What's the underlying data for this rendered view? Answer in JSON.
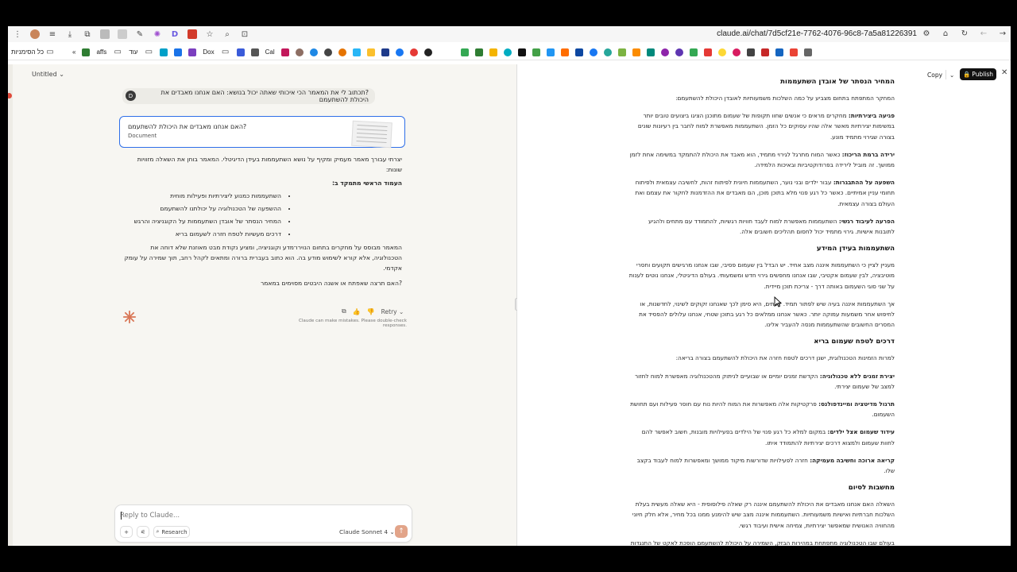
{
  "browser": {
    "url": "claude.ai/chat/7d5cf21e-7762-4076-96c8-7a5a81226391"
  },
  "bookmarks": {
    "first_label": "כל הסימניות",
    "more_label": "«",
    "items": [
      "affs",
      "עוד",
      "Dox",
      "Cal"
    ]
  },
  "chat": {
    "title": "Untitled",
    "user_avatar": "D",
    "user_message": "?תכתוב לי את המאמר הכי איכותי שאתה יכול בנושא: האם אנחנו מאבדים את היכולת להשתעמם",
    "doc_card": {
      "title": "?האם אנחנו מאבדים את היכולת להשתעמם",
      "subtitle": "Document"
    },
    "answer": {
      "intro": "יצרתי עבורך מאמר מעמיק ומקיף על נושא השתעממות בעידן הדיגיטלי. המאמר בוחן את השאלה מזוויות שונות:",
      "heading": "העמוד הראשי מתמקד ב:",
      "bullets": [
        "השתעממות כמנוע ליצירתיות ופעילות מוחית",
        "ההשפעה של הטכנולוגיה על יכולתנו להשתעמם",
        "המחיר הנסתר של אובדן השתעממות על הקוגניציה והרגש",
        "דרכים מעשיות לטפח חזרה לשעמום בריא"
      ],
      "para2": "המאמר מבוסס על מחקרים בתחום הנוירו־מדע וקוגניציה, ומציע נקודת מבט מאוזנת שלא דוחה את הטכנולוגיה, אלא קורא לשימוש מודע בה. הוא כתוב בעברית ברורה ומתאים לקהל רחב, תוך שמירה על עומק אקדמי.",
      "question": "?האם תרצה שאפתח או אשנה היבטים מסוימים במאמר"
    },
    "actions": {
      "retry_label": "Retry"
    },
    "disclaimer": "Claude can make mistakes. Please double-check responses.",
    "composer": {
      "placeholder": "Reply to Claude...",
      "research_label": "Research",
      "model_label": "Claude Sonnet 4"
    }
  },
  "artifact": {
    "copy_label": "Copy",
    "publish_label": "Publish",
    "sections": [
      {
        "heading": "המחיר הנסתר של אובדן השתעממות",
        "intro": "המחקר המתפתח בתחום מצביע על כמה השלכות משמעותיות לאובדן היכולת להשתעמם:",
        "items": [
          {
            "bold": "פגיעה ביצירתיות:",
            "text": "מחקרים מראים כי אנשים שחוו תקופות של שעמום מתוכנן הציגו ביצועים טובים יותר במשימות יצירתיות מאשר אלה שהיו עסוקים כל הזמן. השתעממות מאפשרת למוח לחבר בין רעיונות שונים בצורה שגירוי מתמיד מונע."
          },
          {
            "bold": "ירידה ברמת הריכוז:",
            "text": "כאשר המוח מתרגל לגירוי מתמיד, הוא מאבד את היכולת להתמקד במשימה אחת לזמן ממושך. זה מוביל לירידה בפרודוקטיביות ובאיכות הלמידה."
          },
          {
            "bold": "השפעה על ההתבגרות:",
            "text": "עבור ילדים ובני נוער, השתעממות חיונית לפיתוח זהות, לחשיבה עצמאית ולפיתוח תחומי עניין אמיתיים. כאשר כל רגע פנוי מלא בתוכן מוכן, הם מאבדים את ההזדמנות לחקור את עצמם ואת העולם בצורה עצמאית."
          },
          {
            "bold": "הפרעה לעיבוד רגשי:",
            "text": "השתעממות מאפשרת למוח לעבד חוויות רגשיות, להתמודד עם מתחים ולהגיע לתובנות אישיות. גירוי מתמיד יכול לחסום תהליכים חשובים אלה."
          }
        ]
      },
      {
        "heading": "השתעממות בעידן המידע",
        "paragraphs": [
          "מעניין לציין כי השתעממות איננה מצב אחיד. יש הבדל בין שעמום פסיבי, שבו אנחנו מרגישים תקועים וחסרי מוטיבציה, לבין שעמום אקטיבי, שבו אנחנו מחפשים גירוי חדש ומשמעותי. בעולם הדיגיטלי, אנחנו נוטים לענות על שני סוגי השעמום באותה דרך - צריכת תוכן מיידית.",
          "אך השתעממות איננה בעיה שיש לפתור תמיד. לעתים, היא סימן לכך שאנחנו זקוקים לשינוי, לחדשנות, או לחיפוש אחר משמעות עמוקה יותר. כאשר אנחנו ממלאים כל רגע בתוכן שטחי, אנחנו עלולים להפסיד את המסרים החשובים שהשתעממות מנסה להעביר אלינו."
        ]
      },
      {
        "heading": "דרכים לטפח שעמום בריא",
        "intro": "למרות הזמינות הטכנולוגית, ישנן דרכים לטפח חזרה את היכולת להשתעמם בצורה בריאה:",
        "items": [
          {
            "bold": "יצירת זמנים ללא טכנולוגיה:",
            "text": "הקדשת זמנים יומיים או שבועיים לניתוק מהטכנולוגיה מאפשרת למוח לחזור למצב של שעמום יצירתי."
          },
          {
            "bold": "תרגול מדיטציה ומיינדפולנס:",
            "text": "פרקטיקות אלה מאפשרות את המוח להיות נוח עם חוסר פעילות ועם תחושת השעמום."
          },
          {
            "bold": "עידוד שעמום אצל ילדים:",
            "text": "במקום למלא כל רגע פנוי של הילדים בפעילויות מובנות, חשוב לאפשר להם לחוות שעמום ולמצוא דרכים יצירתיות להתמודד איתו."
          },
          {
            "bold": "קריאה ארוכה וחשיבה מעמיקה:",
            "text": "חזרה לפעילויות שדורשות מיקוד ממושך ומאפשרות למוח לעבוד בקצב שלו."
          }
        ]
      },
      {
        "heading": "מחשבות לסיום",
        "paragraphs": [
          "השאלה האם אנחנו מאבדים את היכולת להשתעמם איננה רק שאלה פילוסופית - היא שאלה מעשית בעלת השלכות חברתיות ואישיות משמעותיות. השתעממות איננה מצב שיש להימנע ממנו בכל מחיר, אלא חלק חיוני מהחוויה האנושית שמאפשר יצירתיות, צמיחה אישית ועיבוד רגשי.",
          "בעולם שבו הטכנולוגיה מתפתחת במהירות הבזק, השמירה על היכולת להשתעמם הופכת לאקט של התנגדות חיובית. זה לא אומר שיש לנטוש את הטכנולוגיה, אלא למצוא איזון בין זמינות לבין זמנים של שקט פנימי."
        ]
      }
    ]
  },
  "colors": {
    "accent_blue": "#2f6fe8",
    "claude_orange": "#d97757",
    "send_button": "#e2a489",
    "publish_bg": "#111111"
  }
}
